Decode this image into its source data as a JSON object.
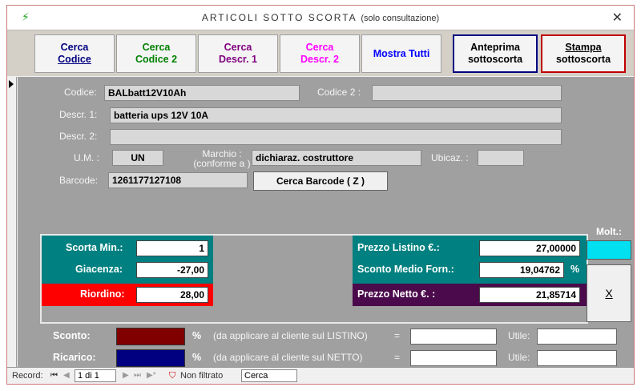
{
  "window": {
    "title": "ARTICOLI SOTTO SCORTA",
    "subtitle": "(solo consultazione)",
    "close_glyph": "✕",
    "app_icon_glyph": "⚡"
  },
  "toolbar": {
    "cerca_codice": {
      "line1": "Cerca",
      "line2": "Codice",
      "color": "#000080"
    },
    "cerca_codice2": {
      "line1": "Cerca",
      "line2": "Codice 2",
      "color": "#008000"
    },
    "cerca_descr1": {
      "line1": "Cerca",
      "line2": "Descr. 1",
      "color": "#800080"
    },
    "cerca_descr2": {
      "line1": "Cerca",
      "line2": "Descr. 2",
      "color": "#ff00ff"
    },
    "mostra_tutti": {
      "label": "Mostra Tutti",
      "color": "#0000ff"
    },
    "anteprima": {
      "line1": "Anteprima",
      "line2": "sottoscorta",
      "border": "#000080"
    },
    "stampa": {
      "line1": "Stampa",
      "line2": "sottoscorta",
      "border": "#c00000"
    }
  },
  "form": {
    "codice_label": "Codice:",
    "codice_value": "BALbatt12V10Ah",
    "codice2_label": "Codice 2 :",
    "codice2_value": "",
    "descr1_label": "Descr. 1:",
    "descr1_value": "batteria ups 12V 10A",
    "descr2_label": "Descr. 2:",
    "descr2_value": "",
    "um_label": "U.M. :",
    "um_value": "UN",
    "marchio_label1": "Marchio :",
    "marchio_label2": "(conforme a )",
    "marchio_value": "dichiaraz. costruttore",
    "ubicaz_label": "Ubicaz. :",
    "ubicaz_value": "",
    "barcode_label": "Barcode:",
    "barcode_value": "1261177127108",
    "cerca_barcode_label": "Cerca Barcode ( Z )"
  },
  "stock": {
    "scorta_min_label": "Scorta Min.:",
    "scorta_min_value": "1",
    "giacenza_label": "Giacenza:",
    "giacenza_value": "-27,00",
    "riordino_label": "Riordino:",
    "riordino_value": "28,00",
    "prezzo_listino_label": "Prezzo Listino  €.:",
    "prezzo_listino_value": "27,00000",
    "sconto_medio_label": "Sconto Medio Forn.:",
    "sconto_medio_value": "19,04762",
    "percent_sign": "%",
    "prezzo_netto_label": "Prezzo Netto  €. :",
    "prezzo_netto_value": "21,85714",
    "molt_label": "Molt.:",
    "molt_value": "",
    "x_button_label": "X"
  },
  "margins": {
    "sconto_label": "Sconto:",
    "sconto_color": "#800000",
    "sconto_percent": "%",
    "sconto_note": "(da applicare al cliente sul LISTINO)",
    "ricarico_label": "Ricarico:",
    "ricarico_color": "#000080",
    "ricarico_percent": "%",
    "ricarico_note": "(da applicare al cliente sul NETTO)",
    "equals": "=",
    "utile_label": "Utile:"
  },
  "statusbar": {
    "record_label": "Record:",
    "record_value": "1 di 1",
    "filter_label": "Non filtrato",
    "search_value": "Cerca"
  }
}
